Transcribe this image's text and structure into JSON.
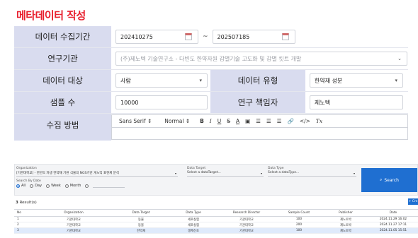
{
  "page_title": "메타데이터 작성",
  "form": {
    "period": {
      "label": "데이터 수집기간",
      "start": "202410275",
      "end": "202507185",
      "sep": "~"
    },
    "institution": {
      "label": "연구기관",
      "placeholder": "(주)제노텍 기술연구소 - 다빈도 한약자원 감별기술 고도화 및 감별 킷트 개발"
    },
    "target": {
      "label": "데이터 대상",
      "value": "사람"
    },
    "type": {
      "label": "데이터 유형",
      "value": "한약재 성분"
    },
    "samples": {
      "label": "샘플 수",
      "value": "10000"
    },
    "director": {
      "label": "연구 책임자",
      "value": "제노텍"
    },
    "method": {
      "label": "수집 방법"
    }
  },
  "editor_toolbar": {
    "font": "Sans Serif",
    "size": "Normal",
    "bold": "B",
    "italic": "I",
    "underline": "U",
    "strike": "S",
    "color": "A",
    "bg": "▣",
    "ol": "☰",
    "ul": "☰",
    "indent": "☰",
    "link": "🔗",
    "code": "</>",
    "clear": "Tx"
  },
  "filter": {
    "org_label": "Organization",
    "org_value": "[기관대학교] - 한반도 자생 한약재 기원 식물의 NGS기반 게노믹 표현체 분석",
    "target_label": "Data Target",
    "target_placeholder": "Select a dataTarget...",
    "type_label": "Data Type",
    "type_placeholder": "Select a dataType...",
    "date_label": "Search By Date",
    "radios": [
      "All",
      "Day",
      "Week",
      "Month"
    ],
    "search_label": "Search",
    "result_count": "3",
    "result_label": "Result(s)",
    "add_label": "+ Cre"
  },
  "table": {
    "headers": [
      "No",
      "Organization",
      "Data Target",
      "Data Type",
      "Research Director",
      "Sample Count",
      "Publisher",
      "Date"
    ],
    "rows": [
      [
        "1",
        "기관대학교",
        "동물",
        "세포실험",
        "기관대학교",
        "100",
        "제노토박",
        "2024.11.29 16:02"
      ],
      [
        "2",
        "기관대학교",
        "동물",
        "세포실험",
        "기관대학교",
        "200",
        "제노토박",
        "2024.11.27 17:11"
      ],
      [
        "3",
        "기관대학교",
        "한약재",
        "생체신호",
        "기관대학교",
        "100",
        "제노토박",
        "2024.11.05 15:51"
      ]
    ]
  }
}
